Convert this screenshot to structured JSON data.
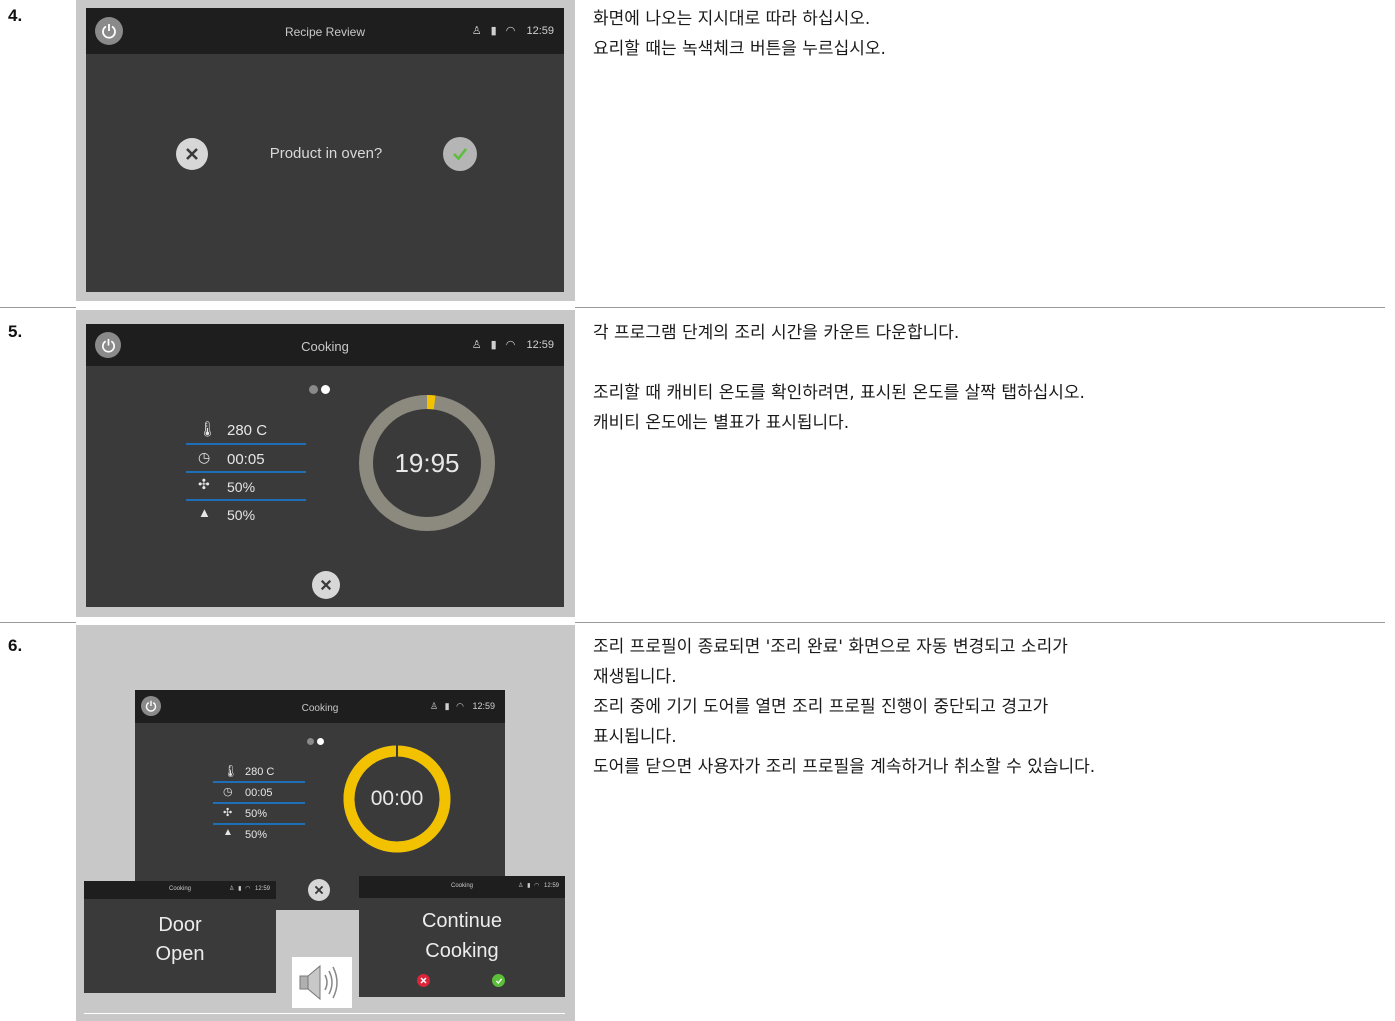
{
  "steps": [
    {
      "number": "4.",
      "screen": {
        "title": "Recipe Review",
        "time": "12:59",
        "prompt": "Product in oven?"
      },
      "description": [
        "화면에 나오는 지시대로 따라 하십시오.",
        "요리할 때는 녹색체크 버튼을 누르십시오."
      ]
    },
    {
      "number": "5.",
      "screen": {
        "title": "Cooking",
        "time": "12:59",
        "params": [
          "280 C",
          "00:05",
          "50%",
          "50%"
        ],
        "timer": "19:95",
        "progress": 0.02
      },
      "description": [
        "각 프로그램 단계의 조리 시간을 카운트 다운합니다.",
        "",
        "조리할 때 캐비티 온도를 확인하려면, 표시된 온도를 살짝 탭하십시오.",
        "캐비티 온도에는 별표가 표시됩니다."
      ]
    },
    {
      "number": "6.",
      "screen": {
        "title": "Cooking",
        "time": "12:59",
        "params": [
          "280 C",
          "00:05",
          "50%",
          "50%"
        ],
        "timer": "00:00",
        "progress": 1.0,
        "door_popup": [
          "Door",
          "Open"
        ],
        "continue_popup": [
          "Continue",
          "Cooking"
        ]
      },
      "description": [
        "조리 프로필이 종료되면 '조리 완료' 화면으로 자동 변경되고 소리가",
        "재생됩니다.",
        "조리 중에 기기 도어를 열면 조리 프로필 진행이 중단되고 경고가",
        "표시됩니다.",
        "도어를 닫으면 사용자가 조리 프로필을 계속하거나 취소할 수 있습니다."
      ]
    }
  ],
  "colors": {
    "accent_yellow": "#f2c200",
    "confirm_green": "#5cbf3a",
    "cancel_red": "#d9263a",
    "param_underline": "#1f6fb8"
  }
}
